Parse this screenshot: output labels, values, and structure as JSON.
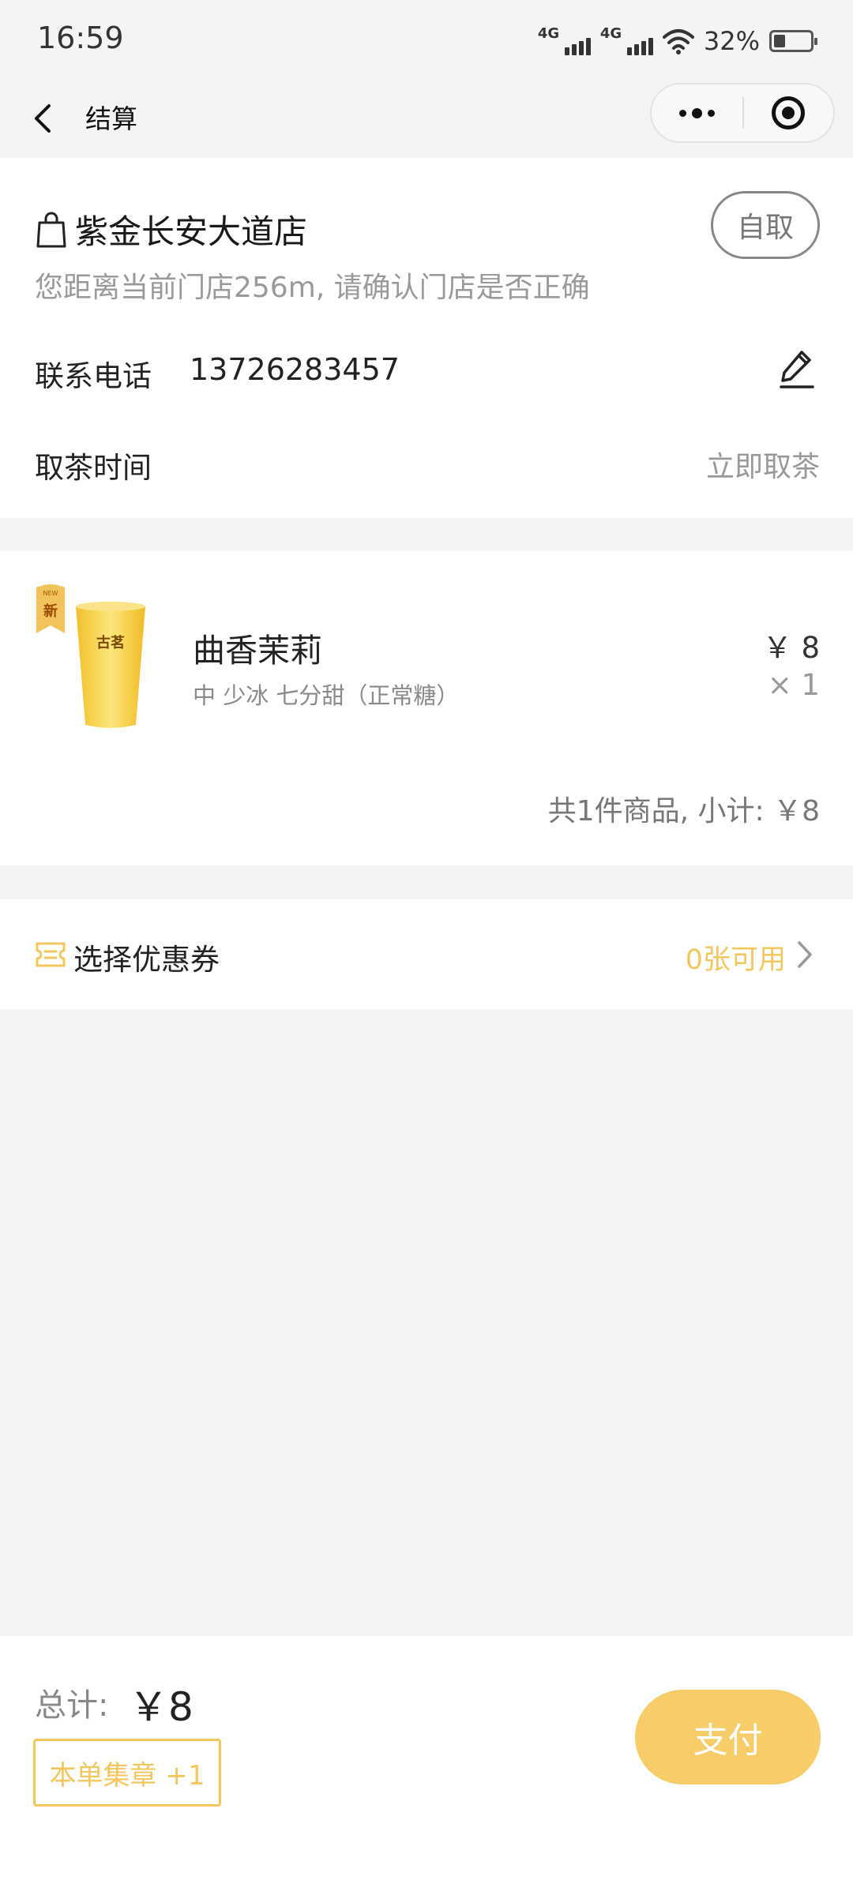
{
  "status_bar": {
    "time": "16:59",
    "signal1_tag": "4G",
    "signal2_tag": "4G",
    "battery_percent": "32%",
    "battery_level": 0.32
  },
  "nav": {
    "title": "结算"
  },
  "store": {
    "name": "紫金长安大道店",
    "pickup_mode": "自取",
    "distance_note": "您距离当前门店256m, 请确认门店是否正确",
    "phone_label": "联系电话",
    "phone_value": "13726283457",
    "pickup_time_label": "取茶时间",
    "pickup_time_value": "立即取茶"
  },
  "order": {
    "item": {
      "badge_top": "NEW",
      "badge_main": "新",
      "cup_brand": "古茗",
      "name": "曲香茉莉",
      "spec": "中 少冰 七分甜（正常糖）",
      "price": "￥ 8",
      "qty": "× 1"
    },
    "subtotal": "共1件商品, 小计: ￥8"
  },
  "coupon": {
    "label": "选择优惠券",
    "available": "0张可用"
  },
  "footer": {
    "total_label": "总计:",
    "total_value": "￥8",
    "stamp_note": "本单集章 +1",
    "pay_label": "支付"
  },
  "colors": {
    "accent": "#f6cd69",
    "coupon_text": "#f3c75d",
    "background": "#f3f4f6"
  }
}
